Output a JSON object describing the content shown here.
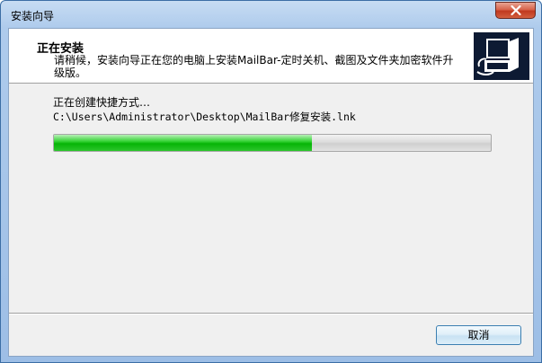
{
  "window": {
    "title": "安装向导"
  },
  "header": {
    "title": "正在安装",
    "description": "请稍候，安装向导正在您的电脑上安装MailBar-定时关机、截图及文件夹加密软件升级版。",
    "icon": "installer-computer-icon"
  },
  "body": {
    "status_text": "正在创建快捷方式…",
    "current_file": "C:\\Users\\Administrator\\Desktop\\MailBar修复安装.lnk",
    "progress_percent": 59
  },
  "buttons": {
    "cancel_label": "取消",
    "close_icon": "close-icon"
  },
  "colors": {
    "progress_green": "#06b406",
    "close_red": "#c0391f",
    "header_icon_bg": "#0d1a33"
  }
}
